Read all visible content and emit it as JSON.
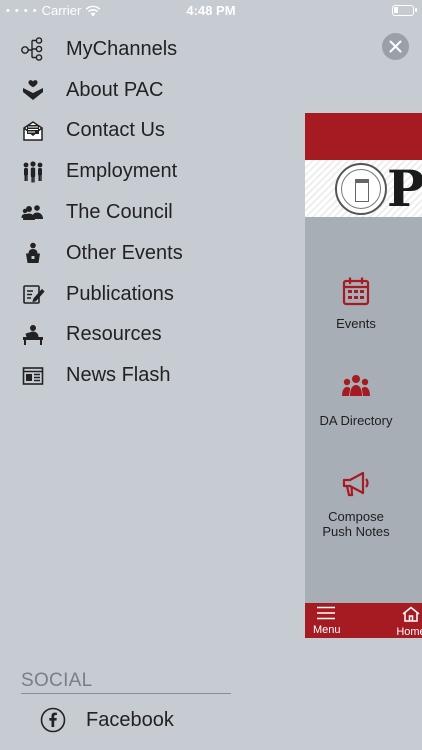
{
  "status_bar": {
    "carrier": "Carrier",
    "time": "4:48 PM"
  },
  "menu": {
    "items": [
      {
        "label": "MyChannels",
        "icon": "network-icon"
      },
      {
        "label": "About PAC",
        "icon": "hand-heart-icon"
      },
      {
        "label": "Contact Us",
        "icon": "mail-icon"
      },
      {
        "label": "Employment",
        "icon": "people-group-icon"
      },
      {
        "label": "The Council",
        "icon": "users-icon"
      },
      {
        "label": "Other Events",
        "icon": "podium-speaker-icon"
      },
      {
        "label": "Publications",
        "icon": "edit-document-icon"
      },
      {
        "label": "Resources",
        "icon": "person-at-desk-icon"
      },
      {
        "label": "News Flash",
        "icon": "newspaper-icon"
      }
    ]
  },
  "preview": {
    "logo_text": "P",
    "tiles": [
      {
        "label": "Events",
        "icon": "calendar-icon"
      },
      {
        "label": "DA Directory",
        "icon": "people-group-icon"
      },
      {
        "label": "Compose Push Notes",
        "icon": "megaphone-icon"
      }
    ],
    "tabs": [
      {
        "label": "Menu",
        "icon": "hamburger-icon"
      },
      {
        "label": "Home",
        "icon": "home-icon"
      }
    ],
    "accent_color": "#a61b22"
  },
  "social": {
    "heading": "SOCIAL",
    "items": [
      {
        "label": "Facebook",
        "icon": "facebook-icon"
      }
    ]
  }
}
